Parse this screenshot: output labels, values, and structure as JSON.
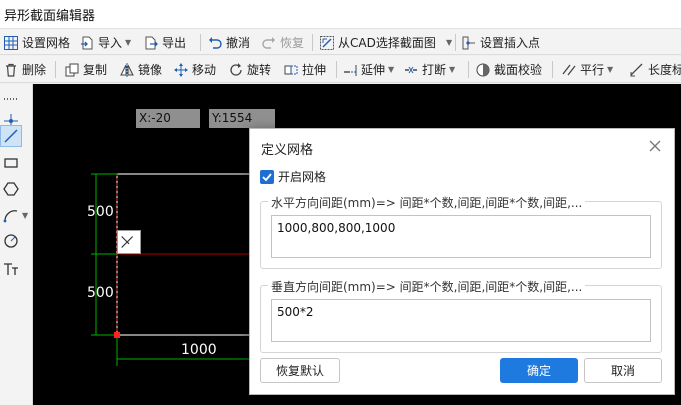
{
  "app": {
    "title": "异形截面编辑器"
  },
  "toolbar1": {
    "grid": "设置网格",
    "import": "导入",
    "export": "导出",
    "undo": "撤消",
    "redo": "恢复",
    "from_cad": "从CAD选择截面图",
    "insert_point": "设置插入点"
  },
  "toolbar2": {
    "delete": "删除",
    "copy": "复制",
    "mirror": "镜像",
    "move": "移动",
    "rotate": "旋转",
    "stretch": "拉伸",
    "extend": "延伸",
    "break": "打断",
    "check": "截面校验",
    "parallel": "平行",
    "length": "长度标"
  },
  "canvas": {
    "coord_x": "X:-20",
    "coord_y": "Y:1554",
    "dim_top": "500",
    "dim_mid": "500",
    "dim_bottom": "1000"
  },
  "colors": {
    "grid_line": "#d8d8d8",
    "dim_line": "#00b000",
    "red_line": "#b00000",
    "accent": "#1f7ae0"
  },
  "dialog": {
    "title": "定义网格",
    "enable_grid": "开启网格",
    "enable_grid_checked": true,
    "horizontal_label": "水平方向间距(mm)=> 间距*个数,间距,间距*个数,间距,...",
    "horizontal_value": "1000,800,800,1000",
    "vertical_label": "垂直方向间距(mm)=> 间距*个数,间距,间距*个数,间距,...",
    "vertical_value": "500*2",
    "restore_default": "恢复默认",
    "ok": "确定",
    "cancel": "取消"
  }
}
